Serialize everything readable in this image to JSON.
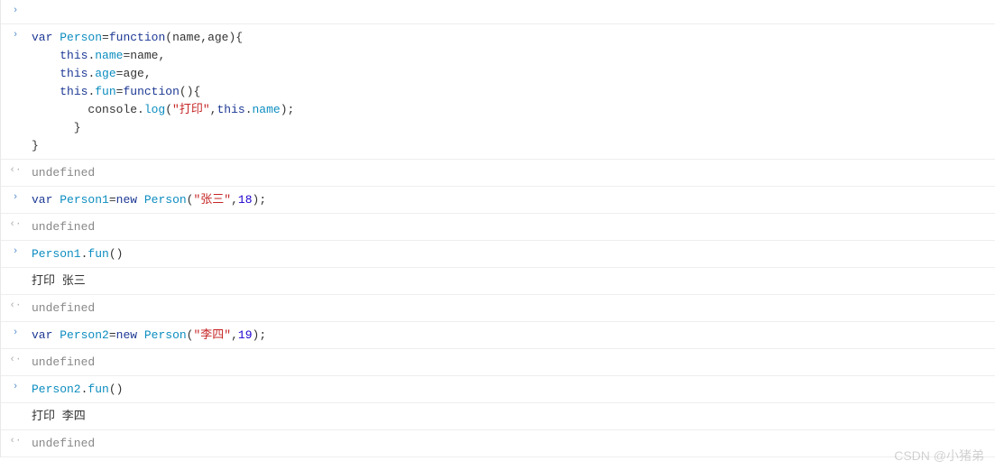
{
  "entries": [
    {
      "type": "input-empty"
    },
    {
      "type": "input-code",
      "code": {
        "lines": [
          [
            {
              "t": "var",
              "c": "kw"
            },
            {
              "t": " ",
              "c": "plain"
            },
            {
              "t": "Person",
              "c": "ident"
            },
            {
              "t": "=",
              "c": "punc"
            },
            {
              "t": "function",
              "c": "kw"
            },
            {
              "t": "(name,age){",
              "c": "punc"
            }
          ],
          [
            {
              "t": "    ",
              "c": "plain"
            },
            {
              "t": "this",
              "c": "kw"
            },
            {
              "t": ".",
              "c": "punc"
            },
            {
              "t": "name",
              "c": "ident"
            },
            {
              "t": "=name,",
              "c": "punc"
            }
          ],
          [
            {
              "t": "    ",
              "c": "plain"
            },
            {
              "t": "this",
              "c": "kw"
            },
            {
              "t": ".",
              "c": "punc"
            },
            {
              "t": "age",
              "c": "ident"
            },
            {
              "t": "=age,",
              "c": "punc"
            }
          ],
          [
            {
              "t": "    ",
              "c": "plain"
            },
            {
              "t": "this",
              "c": "kw"
            },
            {
              "t": ".",
              "c": "punc"
            },
            {
              "t": "fun",
              "c": "ident"
            },
            {
              "t": "=",
              "c": "punc"
            },
            {
              "t": "function",
              "c": "kw"
            },
            {
              "t": "(){",
              "c": "punc"
            }
          ],
          [
            {
              "t": "        console.",
              "c": "plain"
            },
            {
              "t": "log",
              "c": "ident"
            },
            {
              "t": "(",
              "c": "punc"
            },
            {
              "t": "\"打印\"",
              "c": "str"
            },
            {
              "t": ",",
              "c": "punc"
            },
            {
              "t": "this",
              "c": "kw"
            },
            {
              "t": ".",
              "c": "punc"
            },
            {
              "t": "name",
              "c": "ident"
            },
            {
              "t": ");",
              "c": "punc"
            }
          ],
          [
            {
              "t": "      }",
              "c": "punc"
            }
          ],
          [
            {
              "t": "}",
              "c": "punc"
            }
          ]
        ]
      }
    },
    {
      "type": "output-undefined",
      "text": "undefined"
    },
    {
      "type": "input-code",
      "code": {
        "lines": [
          [
            {
              "t": "var",
              "c": "kw"
            },
            {
              "t": " ",
              "c": "plain"
            },
            {
              "t": "Person1",
              "c": "ident"
            },
            {
              "t": "=",
              "c": "punc"
            },
            {
              "t": "new",
              "c": "kw"
            },
            {
              "t": " ",
              "c": "plain"
            },
            {
              "t": "Person",
              "c": "ident"
            },
            {
              "t": "(",
              "c": "punc"
            },
            {
              "t": "\"张三\"",
              "c": "str"
            },
            {
              "t": ",",
              "c": "punc"
            },
            {
              "t": "18",
              "c": "num"
            },
            {
              "t": ");",
              "c": "punc"
            }
          ]
        ]
      }
    },
    {
      "type": "output-undefined",
      "text": "undefined"
    },
    {
      "type": "input-code",
      "code": {
        "lines": [
          [
            {
              "t": "Person1",
              "c": "ident"
            },
            {
              "t": ".",
              "c": "punc"
            },
            {
              "t": "fun",
              "c": "ident"
            },
            {
              "t": "()",
              "c": "punc"
            }
          ]
        ]
      }
    },
    {
      "type": "log-output",
      "text": "打印 张三"
    },
    {
      "type": "output-undefined",
      "text": "undefined"
    },
    {
      "type": "input-code",
      "code": {
        "lines": [
          [
            {
              "t": "var",
              "c": "kw"
            },
            {
              "t": " ",
              "c": "plain"
            },
            {
              "t": "Person2",
              "c": "ident"
            },
            {
              "t": "=",
              "c": "punc"
            },
            {
              "t": "new",
              "c": "kw"
            },
            {
              "t": " ",
              "c": "plain"
            },
            {
              "t": "Person",
              "c": "ident"
            },
            {
              "t": "(",
              "c": "punc"
            },
            {
              "t": "\"李四\"",
              "c": "str"
            },
            {
              "t": ",",
              "c": "punc"
            },
            {
              "t": "19",
              "c": "num"
            },
            {
              "t": ");",
              "c": "punc"
            }
          ]
        ]
      }
    },
    {
      "type": "output-undefined",
      "text": "undefined"
    },
    {
      "type": "input-code",
      "code": {
        "lines": [
          [
            {
              "t": "Person2",
              "c": "ident"
            },
            {
              "t": ".",
              "c": "punc"
            },
            {
              "t": "fun",
              "c": "ident"
            },
            {
              "t": "()",
              "c": "punc"
            }
          ]
        ]
      }
    },
    {
      "type": "log-output",
      "text": "打印 李四"
    },
    {
      "type": "output-undefined",
      "text": "undefined"
    }
  ],
  "markers": {
    "input": "›",
    "output": "‹·"
  },
  "watermark": "CSDN @小猪弟"
}
